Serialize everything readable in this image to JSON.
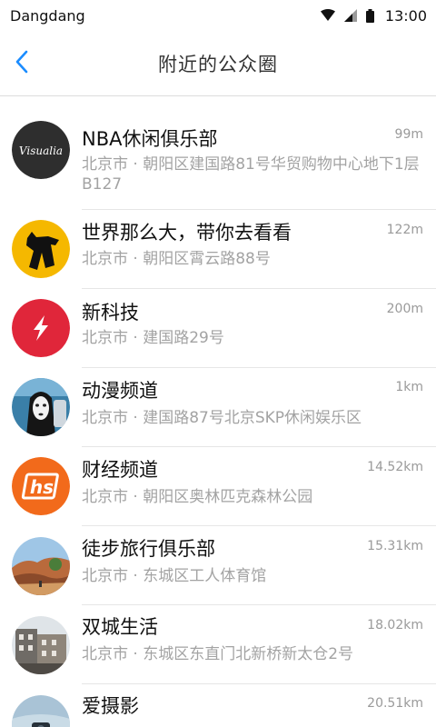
{
  "status_bar": {
    "carrier": "Dangdang",
    "time": "13:00",
    "icons": [
      "wifi-icon",
      "signal-icon",
      "battery-icon"
    ]
  },
  "nav": {
    "title": "附近的公众圈",
    "back_icon": "chevron-left-icon",
    "accent": "#1a8cff"
  },
  "circles": [
    {
      "name": "NBA休闲俱乐部",
      "distance": "99m",
      "address": "北京市 · 朝阳区建国路81号华贸购物中心地下1层B127",
      "avatar": "visualia-logo",
      "avatar_text": "Visualia",
      "avatar_color": "#2e2e2e"
    },
    {
      "name": "世界那么大，带你去看看",
      "distance": "122m",
      "address": "北京市 · 朝阳区霄云路88号",
      "avatar": "dog-silhouette-logo",
      "avatar_color": "#f5b800"
    },
    {
      "name": "新科技",
      "distance": "200m",
      "address": "北京市 · 建国路29号",
      "avatar": "lightning-bolt-logo",
      "avatar_color": "#e0263a"
    },
    {
      "name": "动漫频道",
      "distance": "1km",
      "address": "北京市 · 建国路87号北京SKP休闲娱乐区",
      "avatar": "anime-mask-photo",
      "avatar_color": "#3a7fa8"
    },
    {
      "name": "财经频道",
      "distance": "14.52km",
      "address": "北京市 · 朝阳区奥林匹克森林公园",
      "avatar": "hs-logo",
      "avatar_text": "hs",
      "avatar_color": "#f26a1b"
    },
    {
      "name": "徒步旅行俱乐部",
      "distance": "15.31km",
      "address": "北京市 · 东城区工人体育馆",
      "avatar": "hiking-landscape-photo",
      "avatar_color": "#b96a3c"
    },
    {
      "name": "双城生活",
      "distance": "18.02km",
      "address": "北京市 · 东城区东直门北新桥新太仓2号",
      "avatar": "city-buildings-photo",
      "avatar_color": "#6f6b66"
    },
    {
      "name": "爱摄影",
      "distance": "20.51km",
      "address": "",
      "avatar": "camera-photo",
      "avatar_color": "#a9c3d6"
    }
  ]
}
